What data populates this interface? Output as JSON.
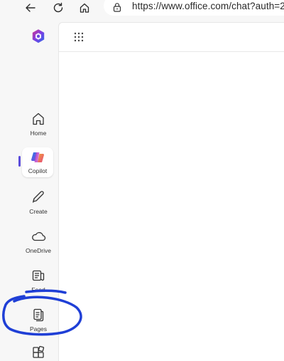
{
  "browser": {
    "url": "https://www.office.com/chat?auth=2"
  },
  "rail": {
    "items": [
      {
        "label": "Home",
        "icon": "home-icon"
      },
      {
        "label": "Copilot",
        "icon": "copilot-icon",
        "active": true
      },
      {
        "label": "Create",
        "icon": "pencil-icon"
      },
      {
        "label": "OneDrive",
        "icon": "cloud-icon"
      },
      {
        "label": "Feed",
        "icon": "feed-icon"
      },
      {
        "label": "Pages",
        "icon": "pages-icon"
      },
      {
        "label": "",
        "icon": "apps-icon"
      }
    ]
  },
  "colors": {
    "active_indicator": "#5b4cdb",
    "annotation_ink": "#1f3fd6"
  }
}
